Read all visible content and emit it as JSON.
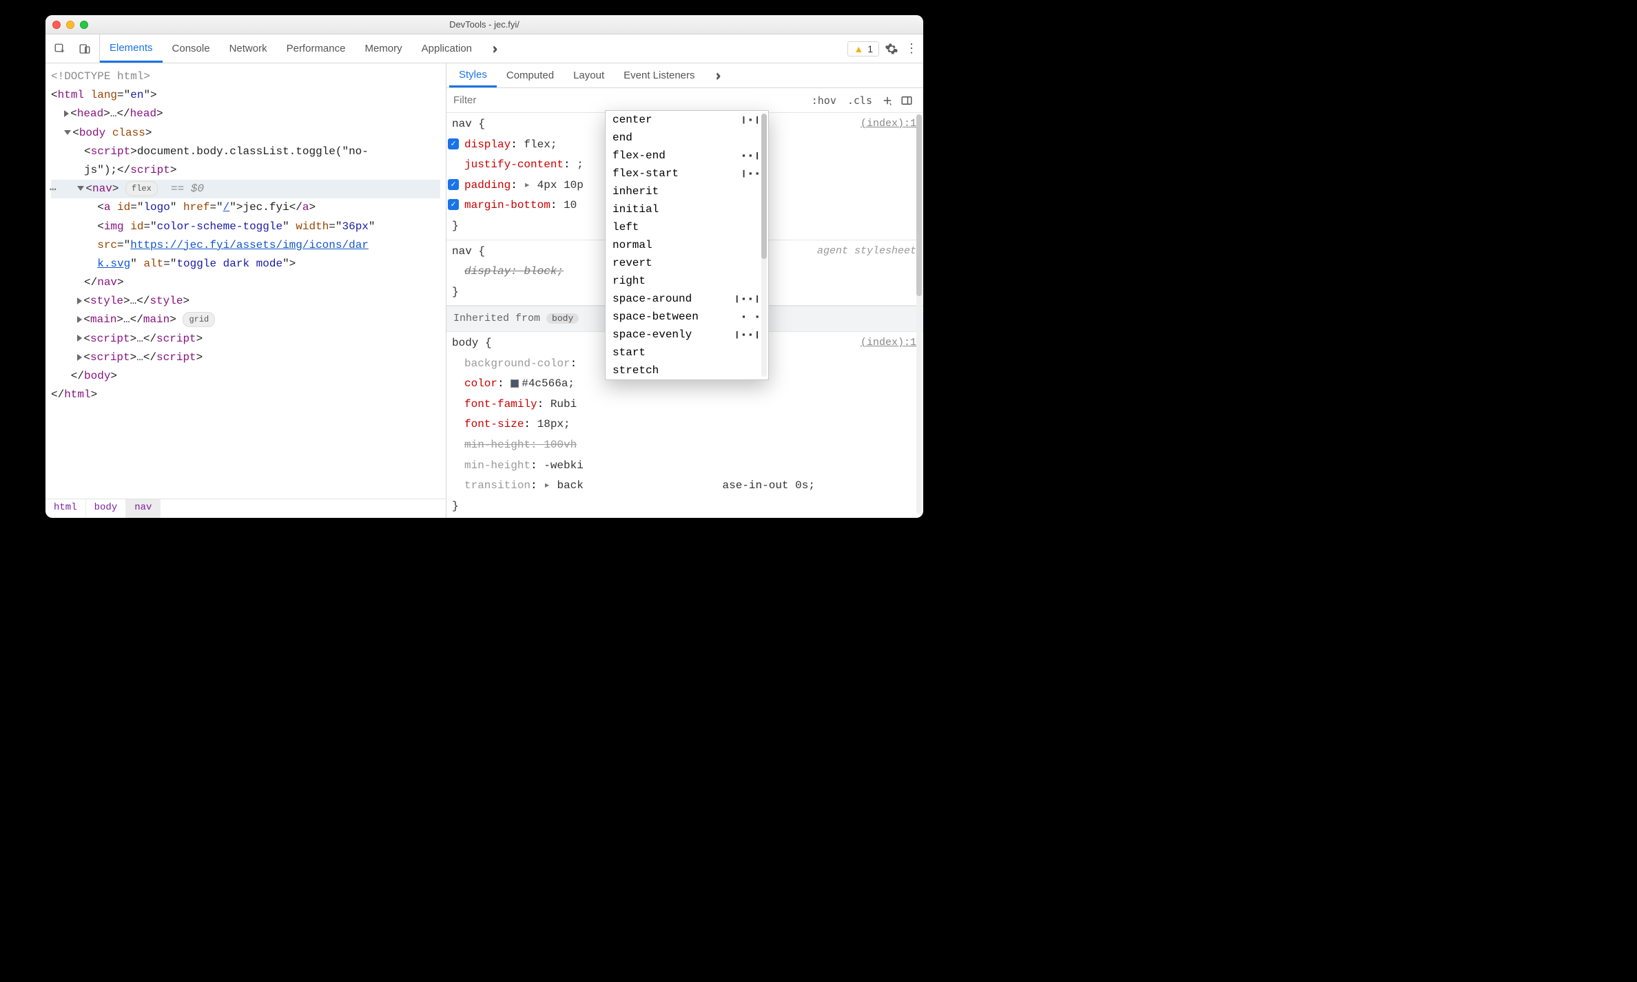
{
  "window": {
    "title": "DevTools - jec.fyi/"
  },
  "toolbar": {
    "tabs": [
      "Elements",
      "Console",
      "Network",
      "Performance",
      "Memory",
      "Application"
    ],
    "active_tab_index": 0,
    "warnings_count": "1"
  },
  "dom": {
    "doctype": "<!DOCTYPE html>",
    "html_open": {
      "tag": "html",
      "attr": "lang",
      "val": "en"
    },
    "head": {
      "tag": "head",
      "ellipsis": "…"
    },
    "body_open": {
      "tag": "body",
      "attr": "class"
    },
    "script_inline": {
      "tag_open": "script",
      "code1": "document.body.classList.toggle(\"no-",
      "code2": "js\");",
      "tag_close": "script"
    },
    "nav": {
      "tag": "nav",
      "pill": "flex",
      "eq0": "== $0"
    },
    "a_logo": {
      "tag": "a",
      "id_attr": "id",
      "id_val": "logo",
      "href_attr": "href",
      "href_val": "/",
      "text": "jec.fyi"
    },
    "img": {
      "tag": "img",
      "id_attr": "id",
      "id_val": "color-scheme-toggle",
      "width_attr": "width",
      "width_val": "36px",
      "src_attr": "src",
      "src_val1": "https://jec.fyi/assets/img/icons/dar",
      "src_val2": "k.svg",
      "alt_attr": "alt",
      "alt_val": "toggle dark mode"
    },
    "nav_close": "nav",
    "style": {
      "tag": "style",
      "ellipsis": "…"
    },
    "main": {
      "tag": "main",
      "ellipsis": "…",
      "pill": "grid"
    },
    "script1": {
      "tag": "script",
      "ellipsis": "…"
    },
    "script2": {
      "tag": "script",
      "ellipsis": "…"
    },
    "body_close": "body",
    "html_close": "html"
  },
  "breadcrumbs": [
    "html",
    "body",
    "nav"
  ],
  "subtabs": {
    "items": [
      "Styles",
      "Computed",
      "Layout",
      "Event Listeners"
    ],
    "active_index": 0
  },
  "filter": {
    "placeholder": "Filter",
    "hov": ":hov",
    "cls": ".cls"
  },
  "styles": {
    "rule1": {
      "selector": "nav",
      "open": "{",
      "close": "}",
      "loc": "(index):1",
      "decls": [
        {
          "checked": true,
          "prop": "display",
          "value": "flex;"
        },
        {
          "checked": false,
          "prop": "justify-content",
          "value": ";",
          "editing": true
        },
        {
          "checked": true,
          "prop": "padding",
          "expand": "▸",
          "value": "4px 10p"
        },
        {
          "checked": true,
          "prop": "margin-bottom",
          "value": "10"
        }
      ]
    },
    "rule2": {
      "selector": "nav",
      "open": "{",
      "close": "}",
      "uas": "agent stylesheet",
      "decl": {
        "prop": "display",
        "value": "block;"
      }
    },
    "inherit_label": "Inherited from",
    "inherit_from": "body",
    "rule3": {
      "selector": "body",
      "open": "{",
      "close": "}",
      "loc": "(index):1",
      "decls": [
        {
          "prop": "background-color",
          "value": "",
          "gray": true
        },
        {
          "prop": "color",
          "value": "#4c566a;",
          "swatch": true
        },
        {
          "prop": "font-family",
          "value": "Rubi"
        },
        {
          "prop": "font-size",
          "value": "18px;"
        },
        {
          "prop": "min-height",
          "value": "100vh",
          "strike": true,
          "gray": true
        },
        {
          "prop": "min-height",
          "value": "-webki",
          "gray": true
        },
        {
          "prop": "transition",
          "expand": "▸",
          "value": "back",
          "tail": "ase-in-out 0s;"
        }
      ]
    }
  },
  "autocomplete": {
    "options": [
      {
        "label": "center",
        "glyph": "❙▪❙"
      },
      {
        "label": "end",
        "glyph": ""
      },
      {
        "label": "flex-end",
        "glyph": "▪▪❙"
      },
      {
        "label": "flex-start",
        "glyph": "❙▪▪"
      },
      {
        "label": "inherit",
        "glyph": ""
      },
      {
        "label": "initial",
        "glyph": ""
      },
      {
        "label": "left",
        "glyph": ""
      },
      {
        "label": "normal",
        "glyph": ""
      },
      {
        "label": "revert",
        "glyph": ""
      },
      {
        "label": "right",
        "glyph": ""
      },
      {
        "label": "space-around",
        "glyph": "❙▪▪❙"
      },
      {
        "label": "space-between",
        "glyph": "▪  ▪"
      },
      {
        "label": "space-evenly",
        "glyph": "❙▪▪❙"
      },
      {
        "label": "start",
        "glyph": ""
      },
      {
        "label": "stretch",
        "glyph": ""
      }
    ]
  }
}
